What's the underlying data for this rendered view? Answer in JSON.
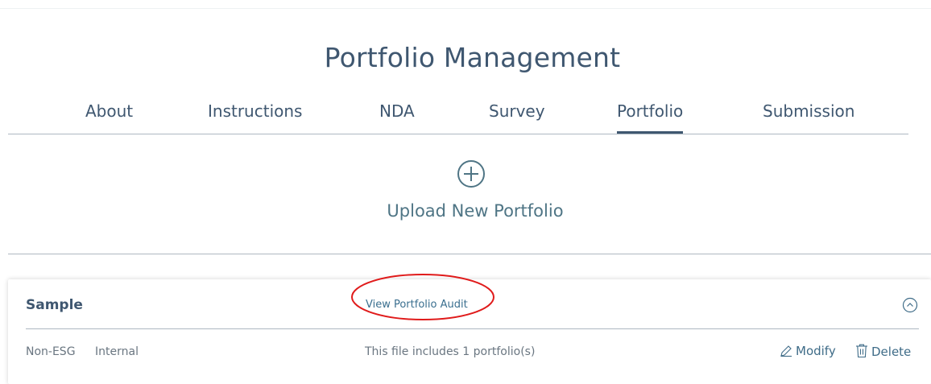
{
  "page": {
    "title": "Portfolio Management"
  },
  "tabs": [
    {
      "label": "About",
      "active": false
    },
    {
      "label": "Instructions",
      "active": false
    },
    {
      "label": "NDA",
      "active": false
    },
    {
      "label": "Survey",
      "active": false
    },
    {
      "label": "Portfolio",
      "active": true
    },
    {
      "label": "Submission",
      "active": false
    }
  ],
  "upload": {
    "label": "Upload New Portfolio",
    "icon": "plus-circle-icon"
  },
  "portfolio_card": {
    "name": "Sample",
    "audit_link": "View Portfolio Audit",
    "type": "Non-ESG",
    "visibility": "Internal",
    "summary": "This file includes 1 portfolio(s)",
    "modify_label": "Modify",
    "delete_label": "Delete",
    "collapse_icon": "chevron-up-circle-icon"
  },
  "colors": {
    "primary_text": "#3f5770",
    "link": "#3a6f8f",
    "annotation_circle": "#e01b1b"
  }
}
